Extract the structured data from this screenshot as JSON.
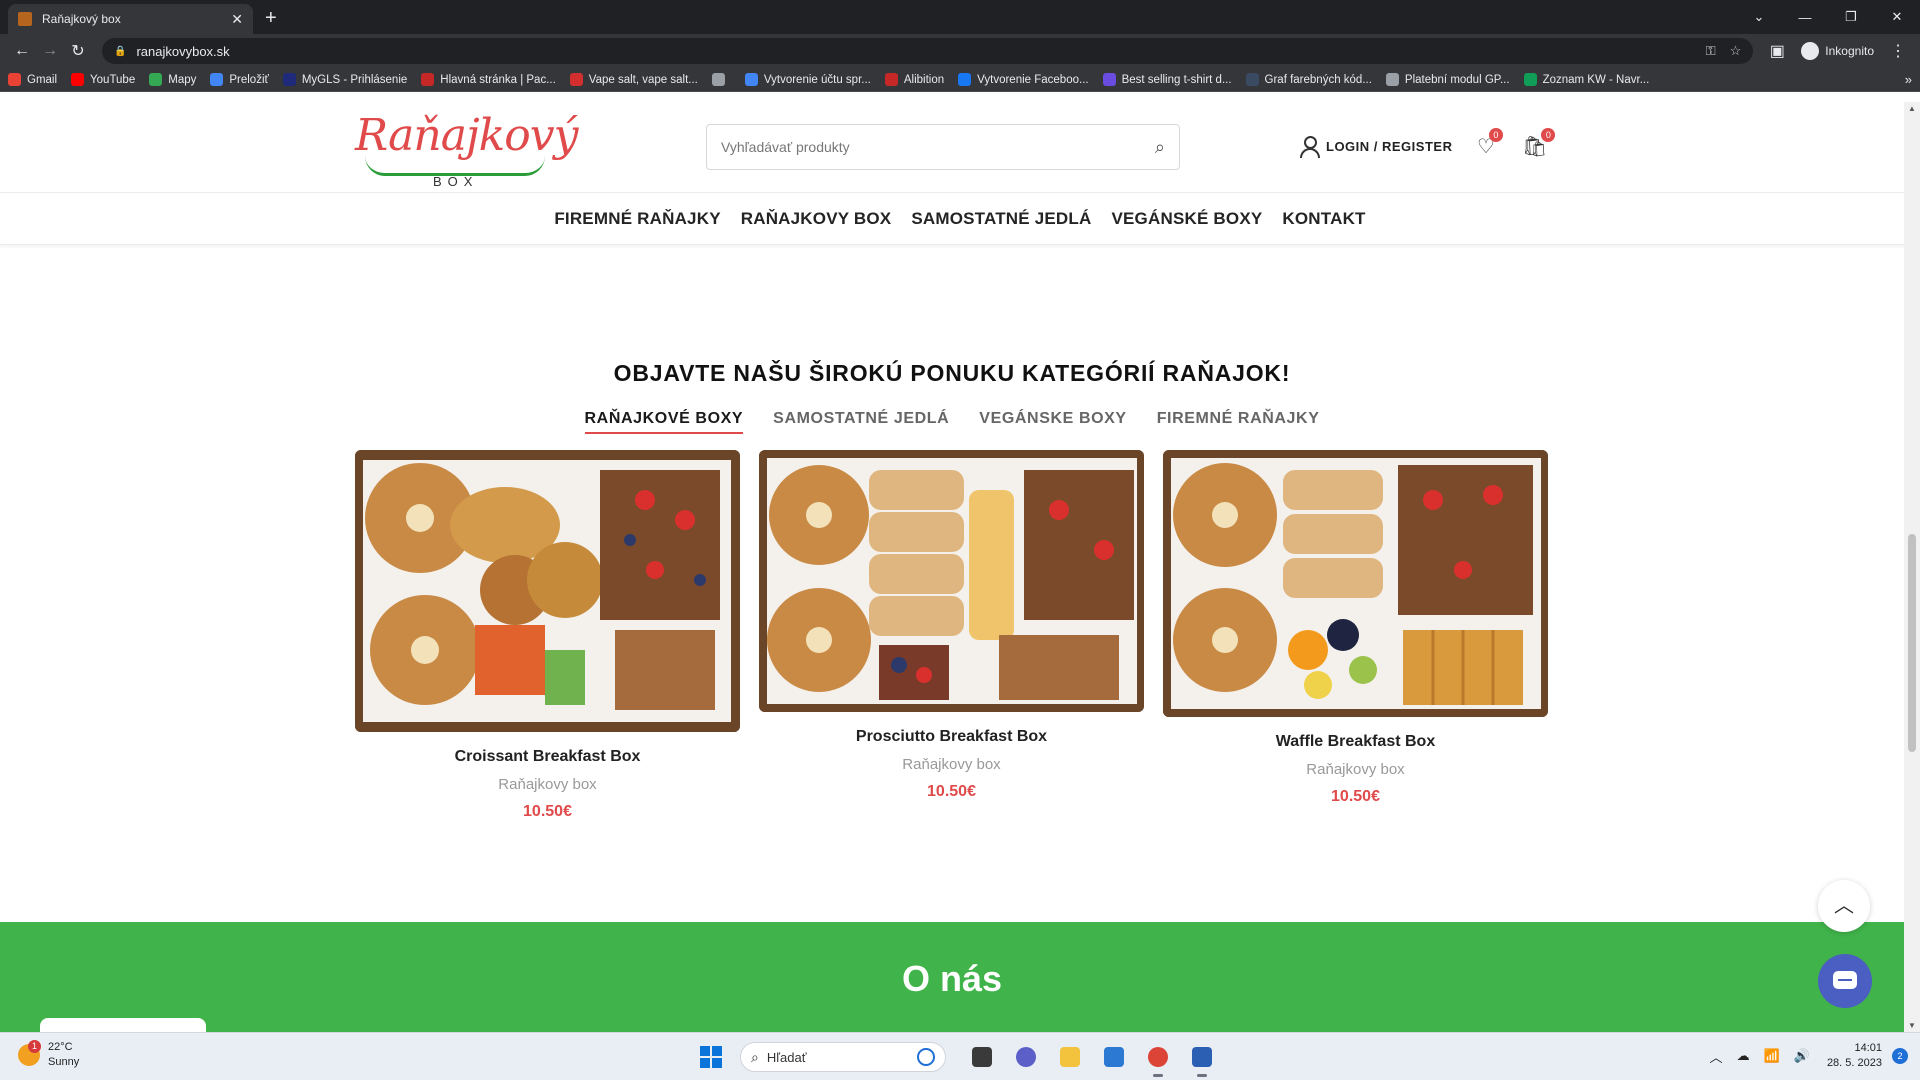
{
  "browser": {
    "tab_title": "Raňajkový box",
    "tab_close": "✕",
    "new_tab": "+",
    "window_controls": [
      "⌄",
      "—",
      "❐",
      "✕"
    ],
    "url": "ranajkovybox.sk",
    "profile_label": "Inkognito",
    "bookmarks": [
      {
        "label": "Gmail",
        "color": "#ea4335"
      },
      {
        "label": "YouTube",
        "color": "#ff0000"
      },
      {
        "label": "Mapy",
        "color": "#34a853"
      },
      {
        "label": "Preložiť",
        "color": "#4285f4"
      },
      {
        "label": "MyGLS - Prihlásenie",
        "color": "#1f2a7a"
      },
      {
        "label": "Hlavná stránka | Pac...",
        "color": "#c62828"
      },
      {
        "label": "Vape salt, vape salt...",
        "color": "#d32f2f"
      },
      {
        "label": "",
        "color": "#9aa0a6"
      },
      {
        "label": "Vytvorenie účtu spr...",
        "color": "#4285f4"
      },
      {
        "label": "Alibition",
        "color": "#c62828"
      },
      {
        "label": "Vytvorenie Faceboo...",
        "color": "#1877f2"
      },
      {
        "label": "Best selling t-shirt d...",
        "color": "#6a4ce0"
      },
      {
        "label": "Graf farebných kód...",
        "color": "#3b4a63"
      },
      {
        "label": "Platební modul GP...",
        "color": "#9aa0a6"
      },
      {
        "label": "Zoznam KW - Navr...",
        "color": "#0f9d58"
      }
    ],
    "bookmarks_more": "»"
  },
  "header": {
    "logo_text": "Raňajkový",
    "logo_sub": "BOX",
    "search_placeholder": "Vyhľadávať produkty",
    "account_label": "LOGIN / REGISTER",
    "wishlist_count": "0",
    "cart_count": "0"
  },
  "nav": [
    "FIREMNÉ RAŇAJKY",
    "RAŇAJKOVY BOX",
    "SAMOSTATNÉ JEDLÁ",
    "VEGÁNSKÉ BOXY",
    "KONTAKT"
  ],
  "section": {
    "title": "OBJAVTE NAŠU ŠIROKÚ PONUKU KATEGÓRIÍ RAŇAJOK!",
    "tabs": [
      "RAŇAJKOVÉ BOXY",
      "SAMOSTATNÉ JEDLÁ",
      "VEGÁNSKE BOXY",
      "FIREMNÉ RAŇAJKY"
    ],
    "active_tab": 0
  },
  "products": [
    {
      "name": "Croissant Breakfast Box",
      "category": "Raňajkovy box",
      "price": "10.50€"
    },
    {
      "name": "Prosciutto Breakfast Box",
      "category": "Raňajkovy box",
      "price": "10.50€"
    },
    {
      "name": "Waffle Breakfast Box",
      "category": "Raňajkovy box",
      "price": "10.50€"
    }
  ],
  "about": {
    "title": "O nás"
  },
  "colors": {
    "accent": "#e04a4a",
    "green": "#40b34a",
    "chat": "#4a5fc1"
  },
  "taskbar": {
    "weather_temp": "22°C",
    "weather_desc": "Sunny",
    "weather_badge": "1",
    "search_placeholder": "Hľadať",
    "time": "14:01",
    "date": "28. 5. 2023",
    "notifications": "2"
  }
}
